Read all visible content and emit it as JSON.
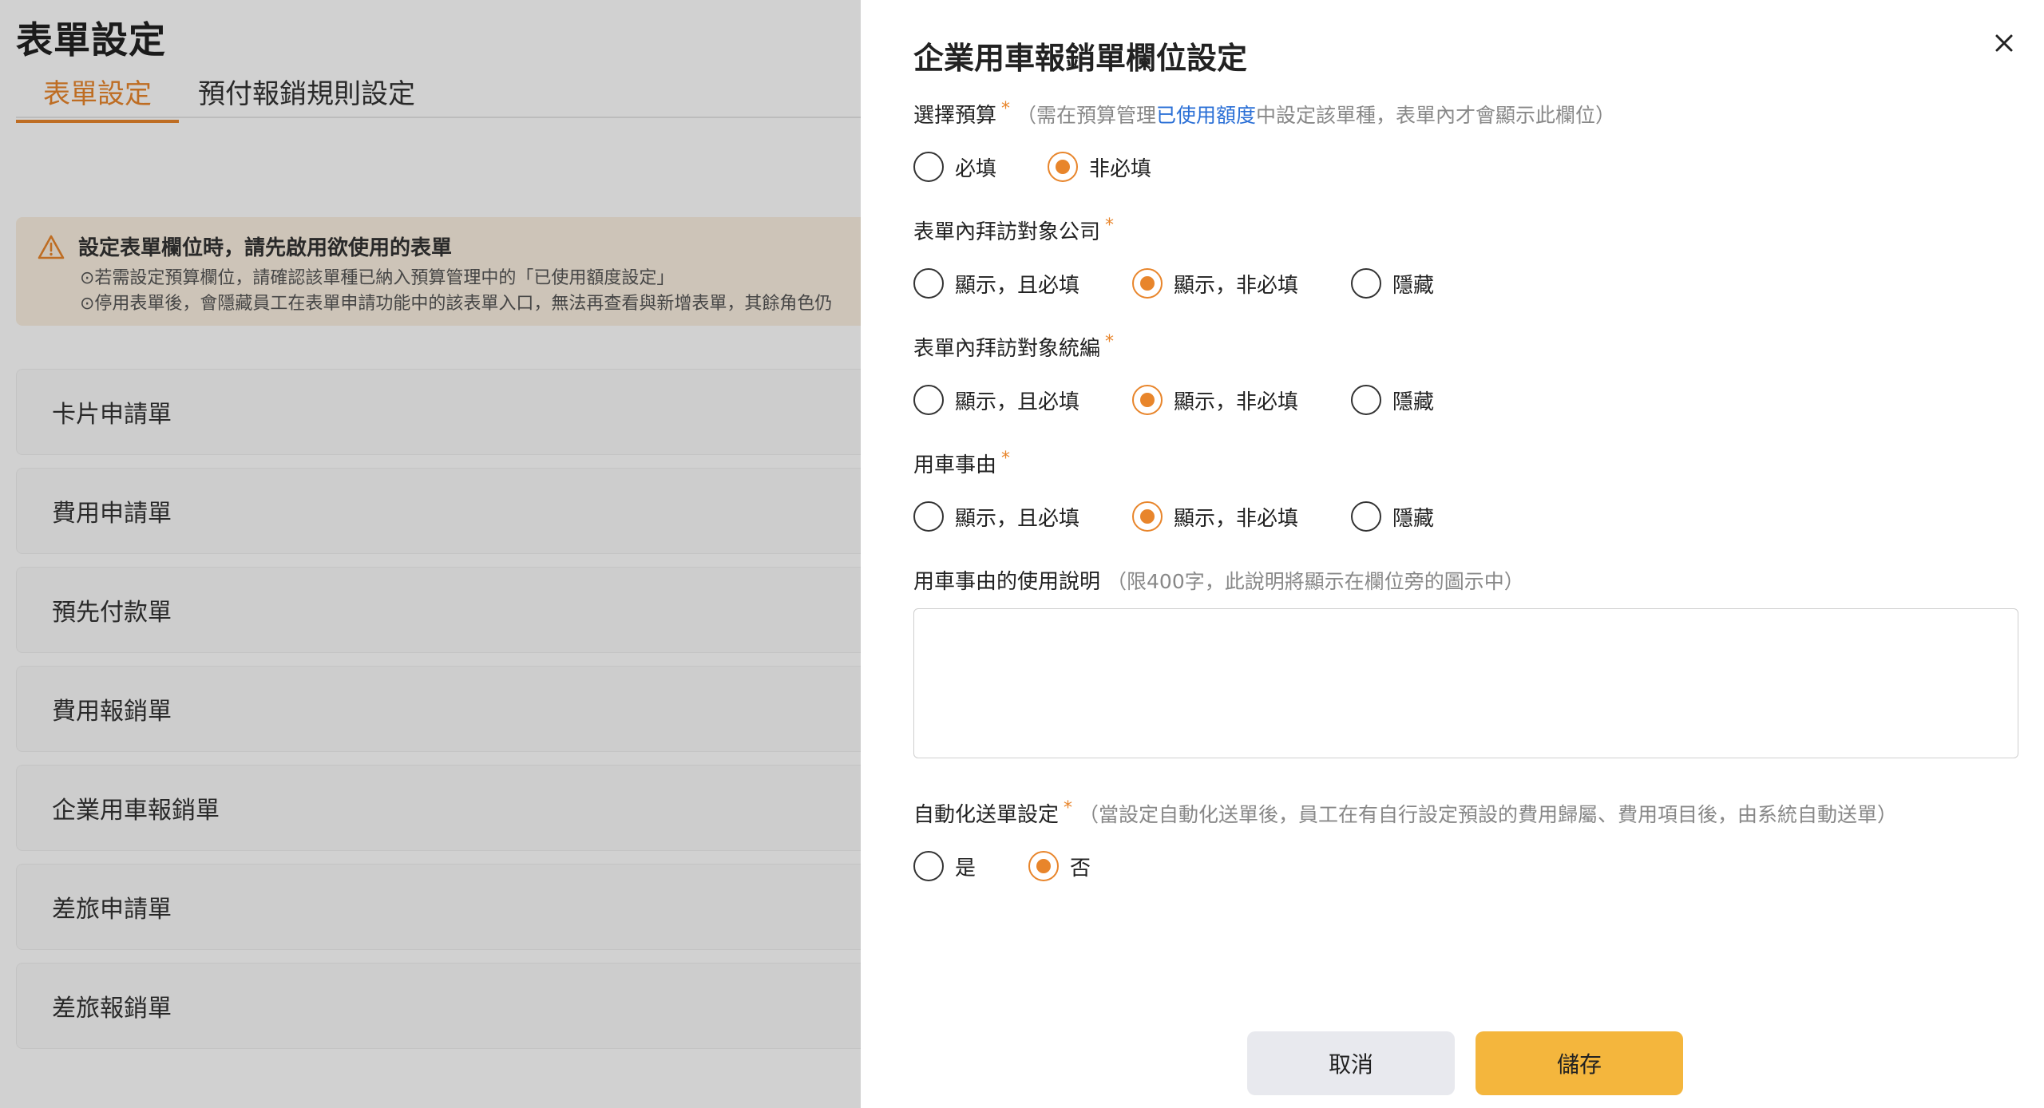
{
  "page": {
    "title": "表單設定",
    "tabs": [
      {
        "label": "表單設定",
        "active": true
      },
      {
        "label": "預付報銷規則設定",
        "active": false
      }
    ],
    "notice": {
      "title": "設定表單欄位時，請先啟用欲使用的表單",
      "lines": [
        "⊙若需設定預算欄位，請確認該單種已納入預算管理中的「已使用額度設定」",
        "⊙停用表單後，會隱藏員工在表單申請功能中的該表單入口，無法再查看與新增表單，其餘角色仍"
      ]
    },
    "forms": [
      "卡片申請單",
      "費用申請單",
      "預先付款單",
      "費用報銷單",
      "企業用車報銷單",
      "差旅申請單",
      "差旅報銷單"
    ]
  },
  "drawer": {
    "title": "企業用車報銷單欄位設定",
    "fields": {
      "budget": {
        "label": "選擇預算",
        "required_mark": "*",
        "hint_before": "（需在預算管理",
        "hint_link": "已使用額度",
        "hint_after": "中設定該單種，表單內才會顯示此欄位）",
        "options": [
          "必填",
          "非必填"
        ],
        "selected": "非必填"
      },
      "visit_company": {
        "label": "表單內拜訪對象公司",
        "required_mark": "*",
        "options": [
          "顯示，且必填",
          "顯示，非必填",
          "隱藏"
        ],
        "selected": "顯示，非必填"
      },
      "visit_taxid": {
        "label": "表單內拜訪對象統編",
        "required_mark": "*",
        "options": [
          "顯示，且必填",
          "顯示，非必填",
          "隱藏"
        ],
        "selected": "顯示，非必填"
      },
      "reason": {
        "label": "用車事由",
        "required_mark": "*",
        "options": [
          "顯示，且必填",
          "顯示，非必填",
          "隱藏"
        ],
        "selected": "顯示，非必填"
      },
      "reason_desc": {
        "label": "用車事由的使用說明",
        "hint": "（限400字，此說明將顯示在欄位旁的圖示中）",
        "value": ""
      },
      "auto_submit": {
        "label": "自動化送單設定",
        "required_mark": "*",
        "hint": "（當設定自動化送單後，員工在有自行設定預設的費用歸屬、費用項目後，由系統自動送單）",
        "options": [
          "是",
          "否"
        ],
        "selected": "否"
      }
    },
    "buttons": {
      "cancel": "取消",
      "save": "儲存"
    }
  },
  "colors": {
    "accent": "#e8852b",
    "link": "#2a6fd6",
    "save_button": "#f4b63d",
    "cancel_button": "#e8e9ee",
    "notice_bg": "#fbf0e1"
  }
}
